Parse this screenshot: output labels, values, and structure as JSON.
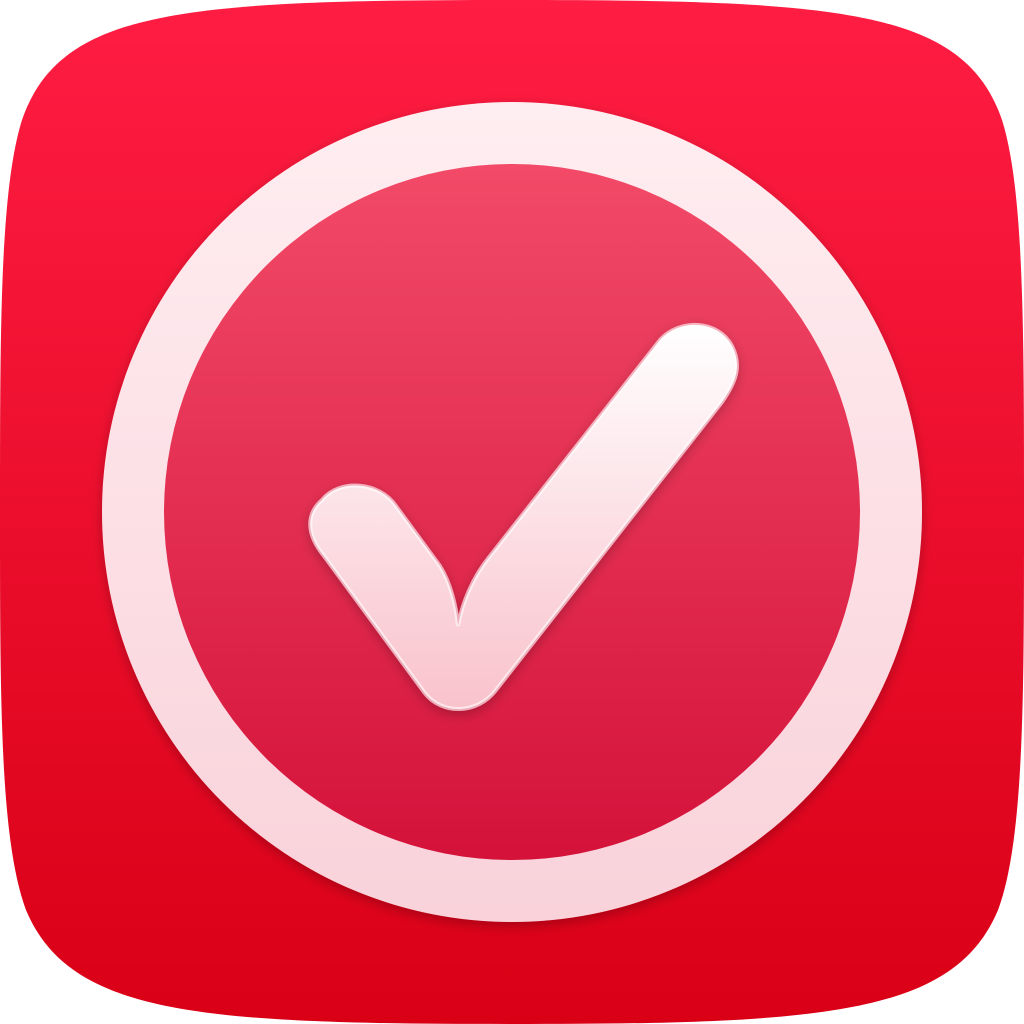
{
  "icon": {
    "name": "checkmark-app-icon",
    "glyph": "check-icon"
  },
  "colors": {
    "background_top": "#ff1d43",
    "background_bottom": "#d90016",
    "disc_top": "#f24a68",
    "disc_bottom": "#d4123a",
    "ring": "#fde0e5",
    "checkmark_top": "#ffffff",
    "checkmark_bottom": "#f9c2cc"
  }
}
